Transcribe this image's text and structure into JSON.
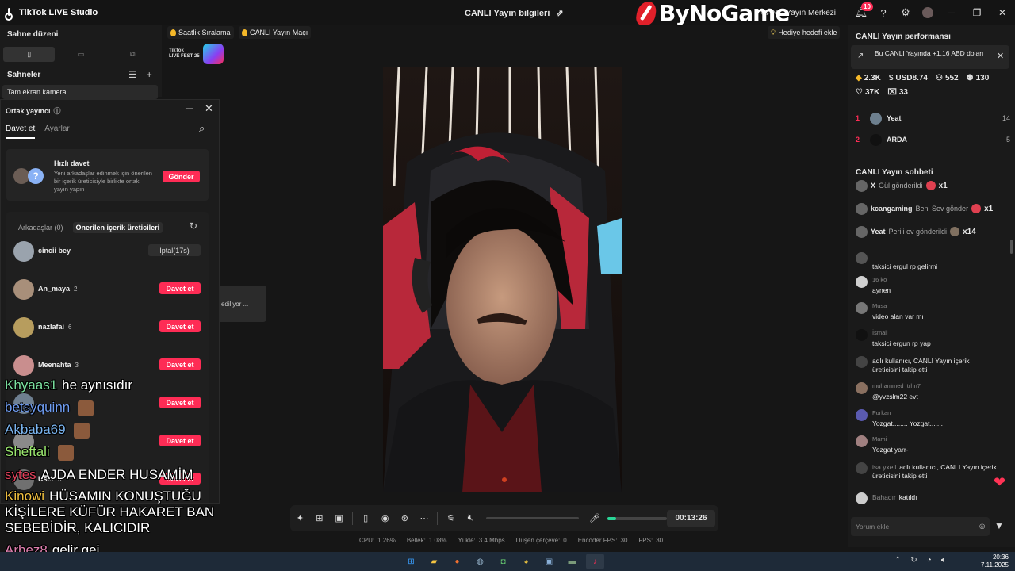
{
  "app": {
    "title": "TikTok LIVE Studio",
    "center_title": "CANLI Yayın bilgileri"
  },
  "watermark": {
    "text": "ByNoGame"
  },
  "header": {
    "live_center": "CANLI Yayın Merkezi",
    "notif_count": "10"
  },
  "left_panel": {
    "scene_layout_title": "Sahne düzeni",
    "scenes_title": "Sahneler",
    "scene_item": "Tam ekran kamera"
  },
  "chips": {
    "hourly": "Saatlik Sıralama",
    "match": "CANLI Yayın Maçı",
    "gift_goal": "Hediye hedefi ekle"
  },
  "fest": {
    "line1": "TikTok",
    "line2": "LIVE FEST 25"
  },
  "popup": {
    "title": "Ortak yayıncı",
    "tab_invite": "Davet et",
    "tab_settings": "Ayarlar",
    "quick_title": "Hızlı davet",
    "quick_desc": "Yeni arkadaşlar edinmek için önerilen bir içerik üreticisiyle birlikte ortak yayın yapın",
    "send_label": "Gönder",
    "friends_tab": "Arkadaşlar (0)",
    "suggested_tab": "Önerilen içerik üreticileri",
    "users": [
      {
        "name": "cincii bey",
        "count": "",
        "action": "İptal(17s)",
        "color": "#9aa3ad"
      },
      {
        "name": "An_maya",
        "count": "2",
        "action": "Davet et",
        "color": "#a88f7a"
      },
      {
        "name": "nazlafai",
        "count": "6",
        "action": "Davet et",
        "color": "#b79d5e"
      },
      {
        "name": "Meenahta",
        "count": "3",
        "action": "Davet et",
        "color": "#c98e8e"
      },
      {
        "name": "",
        "count": "",
        "action": "Davet et",
        "color": "#6e7f90"
      },
      {
        "name": "",
        "count": "",
        "action": "Davet et",
        "color": "#8a8a8a"
      },
      {
        "name": "User",
        "count": "3",
        "action": "Davet et",
        "color": "#707070"
      }
    ]
  },
  "toast": {
    "text": "ediliyor ..."
  },
  "overlay_chat": [
    {
      "name": "Khyaas1",
      "name_color": "#7be0a0",
      "text": "he aynısıdır",
      "emote": false
    },
    {
      "name": "betsyquinn",
      "name_color": "#6f9cf0",
      "text": "",
      "emote": true
    },
    {
      "name": "Akbaba69",
      "name_color": "#7bb5f0",
      "text": "",
      "emote": true
    },
    {
      "name": "Sheftali",
      "name_color": "#9be86f",
      "text": "",
      "emote": true
    },
    {
      "name": "sytes",
      "name_color": "#e0405a",
      "text": "AJDA ENDER HUSAMİM",
      "emote": false
    },
    {
      "name": "Kinowi",
      "name_color": "#f0c040",
      "text": "HÜSAMIN KONUŞTUĞU",
      "emote": false
    },
    {
      "name": "",
      "name_color": "#ffffff",
      "text": "KİŞİLERE KÜFÜR HAKARET BAN",
      "emote": false
    },
    {
      "name": "",
      "name_color": "#ffffff",
      "text": "SEBEBİDİR, KALICIDIR",
      "emote": false
    },
    {
      "name": "Arhez8",
      "name_color": "#e080b0",
      "text": "gelir gei",
      "emote": false
    }
  ],
  "controls": {
    "timer": "00:13:26",
    "mic_level": 0.15
  },
  "stats": [
    {
      "label": "CPU:",
      "value": "1.26%"
    },
    {
      "label": "Bellek:",
      "value": "1.08%"
    },
    {
      "label": "Yükle:",
      "value": "3.4 Mbps"
    },
    {
      "label": "Düşen çerçeve:",
      "value": "0"
    },
    {
      "label": "Encoder FPS:",
      "value": "30"
    },
    {
      "label": "FPS:",
      "value": "30"
    }
  ],
  "right_panel": {
    "perf_title": "CANLI Yayın performansı",
    "earn_text": "Bu CANLI Yayında +1.16 ABD doları",
    "metrics": [
      {
        "icon": "diamond-icon",
        "glyph": "◆",
        "color": "#f5b829",
        "value": "2.3K"
      },
      {
        "icon": "dollar-icon",
        "glyph": "$",
        "color": "#dddddd",
        "value": "USD8.74"
      },
      {
        "icon": "viewers-icon",
        "glyph": "⚇",
        "color": "#dddddd",
        "value": "552"
      },
      {
        "icon": "followers-icon",
        "glyph": "⚉",
        "color": "#dddddd",
        "value": "130"
      },
      {
        "icon": "heart-icon",
        "glyph": "♡",
        "color": "#dddddd",
        "value": "37K"
      },
      {
        "icon": "gift-icon",
        "glyph": "⌧",
        "color": "#dddddd",
        "value": "33"
      }
    ],
    "ranking": [
      {
        "rank": "1",
        "name": "Yeat",
        "value": "14",
        "color": "#6d7f8e"
      },
      {
        "rank": "2",
        "name": "ARDA",
        "value": "5",
        "color": "#111111"
      }
    ],
    "chat_title": "CANLI Yayın sohbeti",
    "gifts": [
      {
        "user": "X",
        "action": "Gül gönderildi",
        "times": "x1",
        "color": "#e04050"
      },
      {
        "user": "kcangaming",
        "action": "Beni Sev gönder",
        "times": "x1",
        "color": "#e04050"
      },
      {
        "user": "Yeat",
        "action": "Perili ev gönderildi",
        "times": "x14",
        "color": "#807060"
      }
    ],
    "messages": [
      {
        "name": "",
        "text": "taksici ergul rp gelirmi",
        "sys": false,
        "color": "#555555"
      },
      {
        "name": "16 ko",
        "text": "aynen",
        "sys": false,
        "color": "#d0d0d0"
      },
      {
        "name": "Musa",
        "text": "video alan var mı",
        "sys": false,
        "color": "#777777"
      },
      {
        "name": "İsmail",
        "text": "taksici ergun rp yap",
        "sys": false,
        "color": "#111111"
      },
      {
        "name": "",
        "text": "adlı kullanıcı, CANLI Yayın içerik üreticisini takip etti",
        "sys": true,
        "color": "#444444"
      },
      {
        "name": "muhammed_trhn7",
        "text": "@yvzslm22 evt",
        "sys": false,
        "color": "#8a7060"
      },
      {
        "name": "Furkan",
        "text": "Yozgat........ Yozgat.......",
        "sys": false,
        "color": "#5a5ab0"
      },
      {
        "name": "Mami",
        "text": "Yozgat yarr-",
        "sys": false,
        "color": "#a08080"
      },
      {
        "name": "isa.yxell",
        "text": "adlı kullanıcı, CANLI Yayın içerik üreticisini takip etti",
        "sys": true,
        "color": "#444444"
      },
      {
        "name": "Bahadır",
        "text": "katıldı",
        "sys": true,
        "color": "#cccccc"
      }
    ],
    "chat_placeholder": "Yorum ekle"
  },
  "taskbar": {
    "time": "20:36",
    "date": "7.11.2025"
  }
}
